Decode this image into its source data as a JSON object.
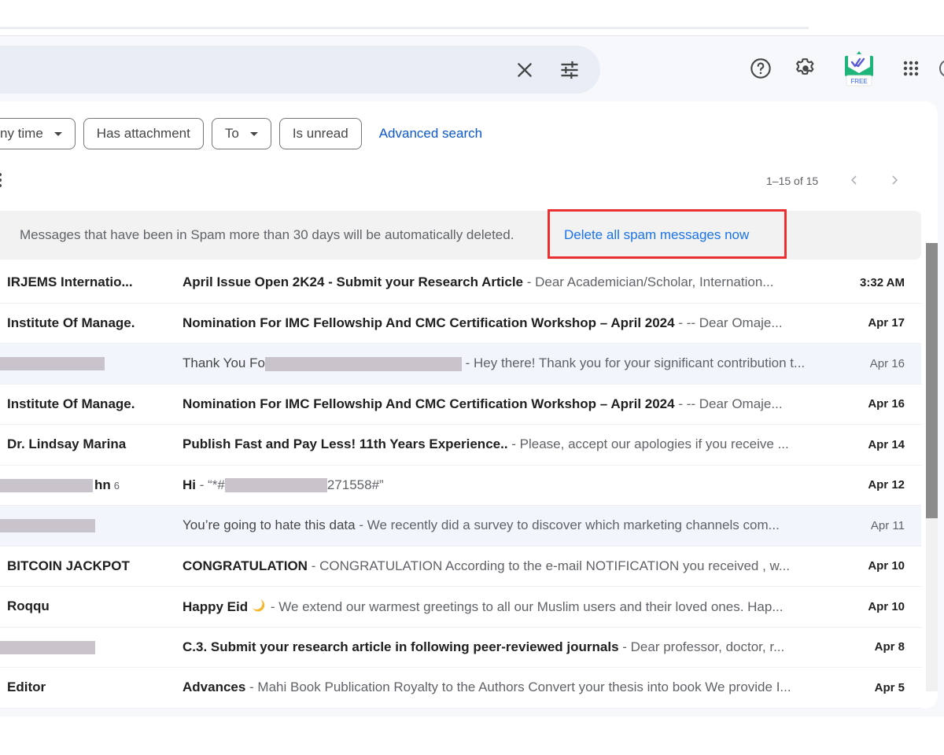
{
  "header": {
    "search_close_icon": "close-icon",
    "search_options_icon": "tune-icon",
    "help_icon": "help-circle-icon",
    "settings_icon": "gear-icon",
    "extension_badge": "FREE",
    "apps_icon": "apps-grid-icon"
  },
  "filters": {
    "chips": [
      {
        "label": "Any time",
        "visible_label": "ny time",
        "has_dropdown": true
      },
      {
        "label": "Has attachment",
        "has_dropdown": false
      },
      {
        "label": "To",
        "has_dropdown": true
      },
      {
        "label": "Is unread",
        "has_dropdown": false
      }
    ],
    "advanced_search": "Advanced search"
  },
  "toolbar": {
    "pagination": "1–15 of 15",
    "prev_icon": "chevron-left-icon",
    "next_icon": "chevron-right-icon"
  },
  "notice": {
    "text": "Messages that have been in Spam more than 30 days will be automatically deleted.",
    "action": "Delete all spam messages now",
    "highlight_color": "#ea3030"
  },
  "colors": {
    "accent_link": "#0b57d0",
    "read_row_bg": "#f2f6fc",
    "search_bg": "#e9eef6",
    "redaction": "#c9c3cc"
  },
  "emails": [
    {
      "sender": "IRJEMS Internatio...",
      "subject": "April Issue Open 2K24 - Submit your Research Article",
      "snippet": " - Dear Academician/Scholar, Internation...",
      "date": "3:32 AM",
      "unread": true
    },
    {
      "sender": "Institute Of Manage.",
      "subject": "Nomination For IMC Fellowship And CMC Certification Workshop – April 2024",
      "snippet": " - -- Dear Omaje...",
      "date": "Apr 17",
      "unread": true
    },
    {
      "sender": "",
      "sender_redacted": true,
      "subject": "Thank You Fo",
      "subject_redacted": true,
      "snippet": " - Hey there! Thank you for your significant contribution t...",
      "date": "Apr 16",
      "unread": false
    },
    {
      "sender": "Institute Of Manage.",
      "subject": "Nomination For IMC Fellowship And CMC Certification Workshop – April 2024",
      "snippet": " - -- Dear Omaje...",
      "date": "Apr 16",
      "unread": true
    },
    {
      "sender": "Dr. Lindsay Marina",
      "subject": "Publish Fast and Pay Less! 11th Years Experience..",
      "snippet": " - Please, accept our apologies if you receive ...",
      "date": "Apr 14",
      "unread": true
    },
    {
      "sender": "hn",
      "sender_redacted": true,
      "thread_count": "6",
      "subject": "Hi",
      "snippet_prefix": " - “*#",
      "snippet_redacted": true,
      "snippet": "271558#”",
      "date": "Apr 12",
      "unread": true
    },
    {
      "sender": "",
      "sender_redacted": true,
      "subject": "You’re going to hate this data",
      "snippet": " - We recently did a survey to discover which marketing channels com...",
      "date": "Apr 11",
      "unread": false
    },
    {
      "sender": "BITCOIN JACKPOT",
      "subject": "CONGRATULATION",
      "snippet": " - CONGRATULATION According to the e-mail NOTIFICATION you received , w...",
      "date": "Apr 10",
      "unread": true
    },
    {
      "sender": "Roqqu",
      "subject": "Happy Eid",
      "subject_icon": "crescent-moon-icon",
      "snippet": " - We extend our warmest greetings to all our Muslim users and their loved ones. Hap...",
      "date": "Apr 10",
      "unread": true
    },
    {
      "sender": "",
      "sender_redacted": true,
      "subject": "C.3. Submit your research article in following peer-reviewed journals",
      "snippet": " - Dear professor, doctor, r...",
      "date": "Apr 8",
      "unread": true
    },
    {
      "sender": "Editor",
      "subject": "Advances",
      "snippet": " - Mahi Book Publication Royalty to the Authors Convert your thesis into book We provide I...",
      "date": "Apr 5",
      "unread": true
    }
  ]
}
